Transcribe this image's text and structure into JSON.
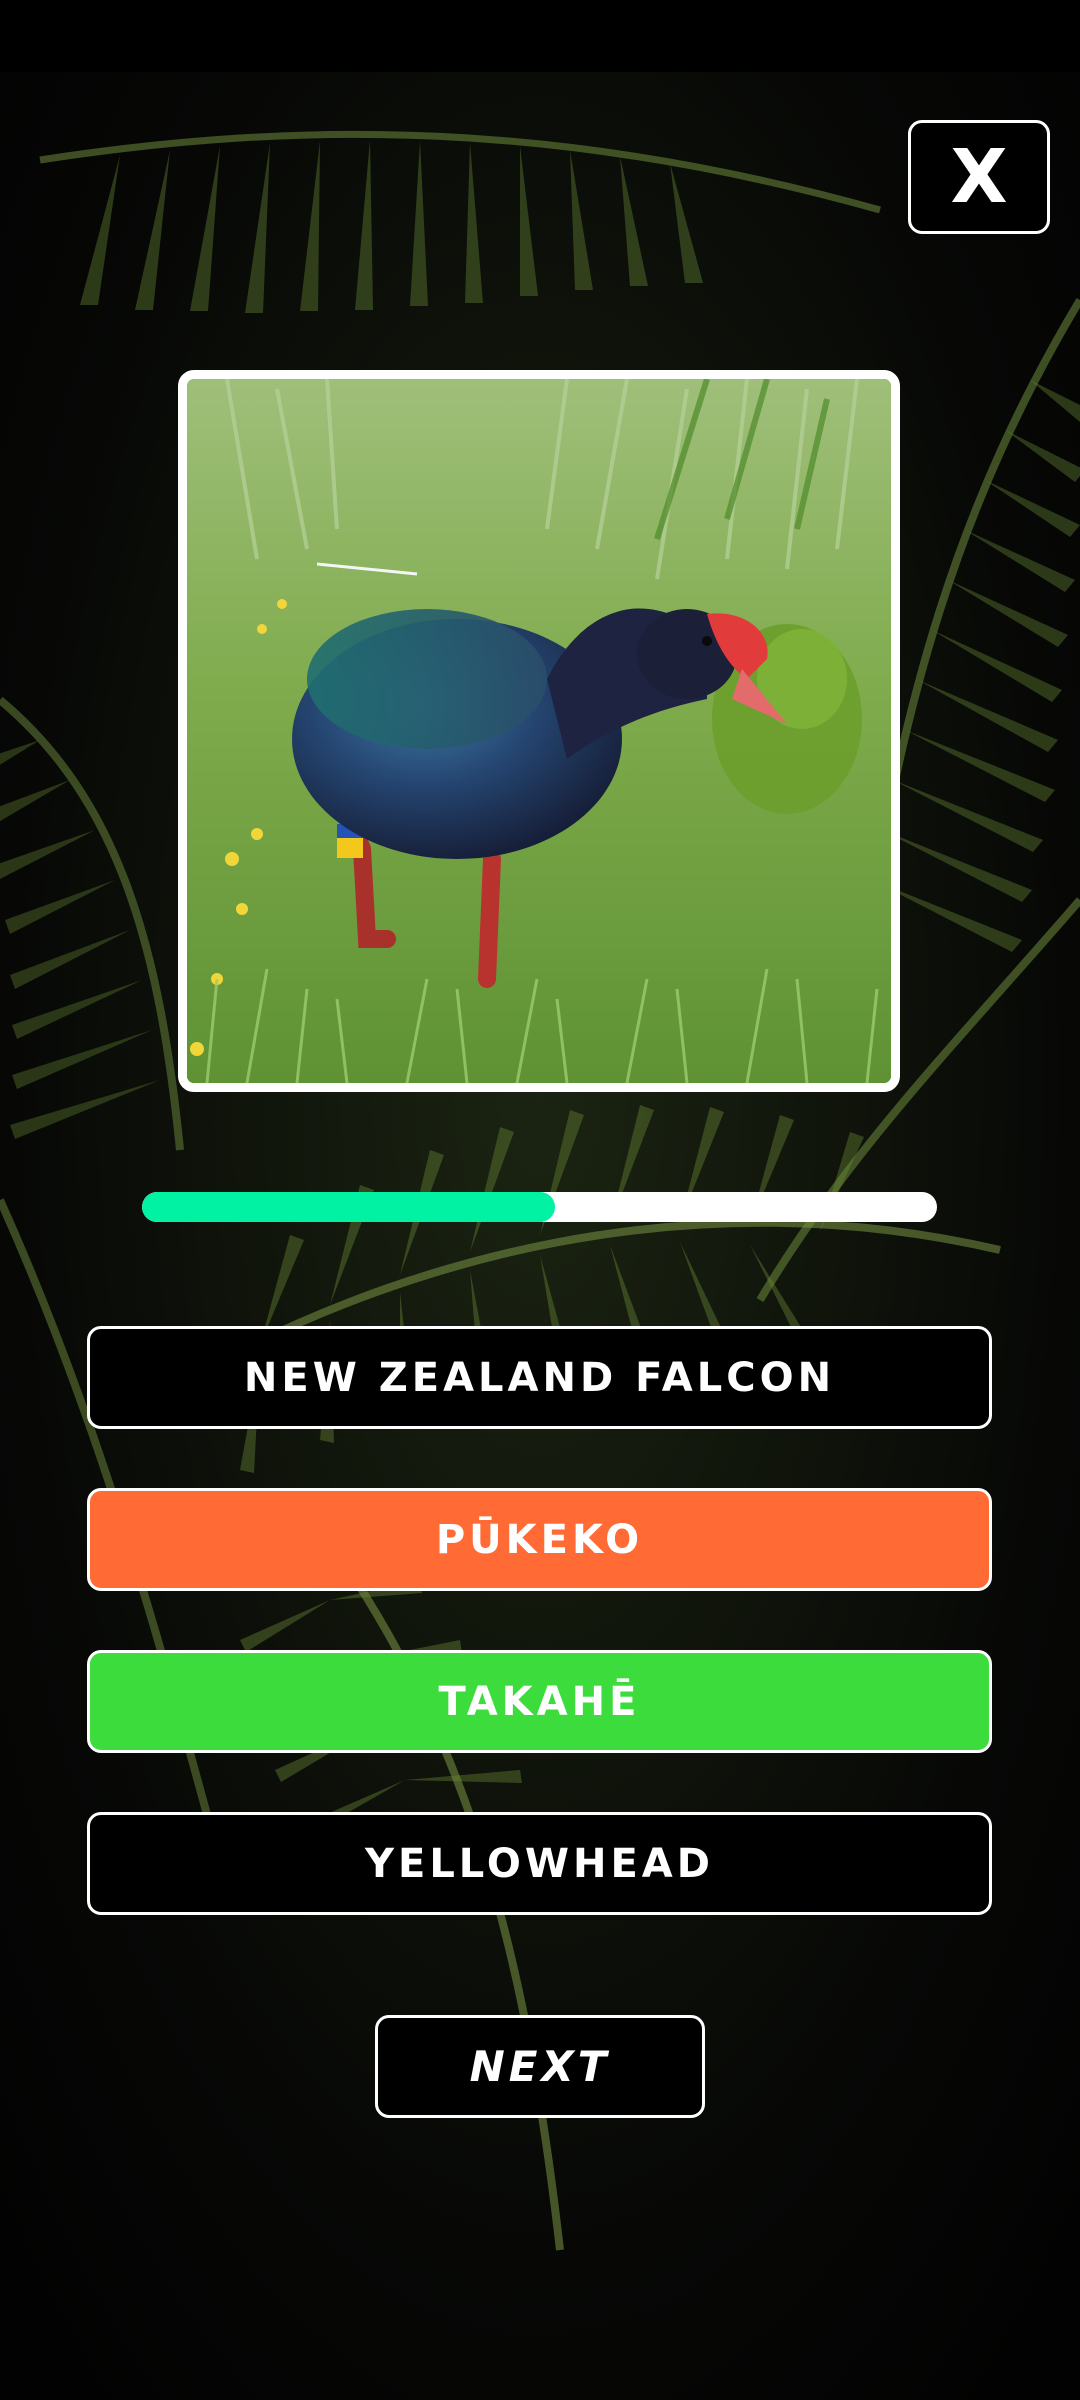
{
  "quiz": {
    "close_label": "X",
    "photo_alt": "Takahē",
    "progress": 0.52,
    "progress_color": "#00F2A2",
    "answers": [
      {
        "label": "NEW ZEALAND FALCON",
        "state": "neutral",
        "color": "#000000"
      },
      {
        "label": "PŪKEKO",
        "state": "wrong",
        "color": "#FF6A35"
      },
      {
        "label": "TAKAHĒ",
        "state": "correct",
        "color": "#3DDC3D"
      },
      {
        "label": "YELLOWHEAD",
        "state": "neutral",
        "color": "#000000"
      }
    ],
    "next_label": "NEXT"
  },
  "icons": {
    "close": "close-icon"
  }
}
